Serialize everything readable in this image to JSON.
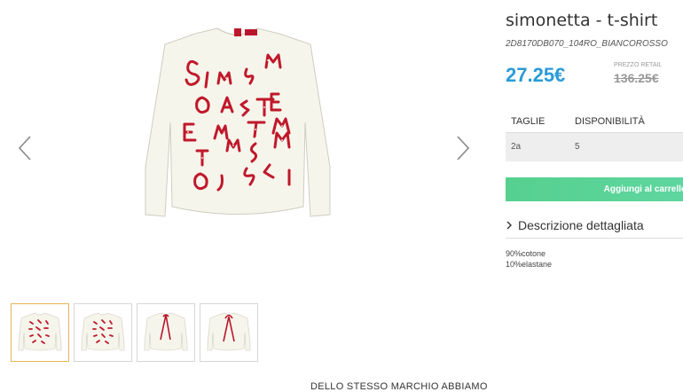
{
  "product": {
    "title": "simonetta - t-shirt",
    "sku": "2D8170DB070_104RO_BIANCOROSSO",
    "price": "27.25€",
    "retail_label": "PREZZO RETAIL",
    "retail_price": "136.25€"
  },
  "sizes": {
    "headers": [
      "TAGLIE",
      "DISPONIBILITÀ"
    ],
    "rows": [
      [
        "2a",
        "5"
      ]
    ]
  },
  "actions": {
    "add_to_cart": "Aggiungi al carrello"
  },
  "description": {
    "toggle_label": "Descrizione dettagliata",
    "composition": [
      "90%cotone",
      "10%elastane"
    ]
  },
  "gallery": {
    "thumbnails": [
      "front-view",
      "front-view-alt",
      "back-view",
      "back-view-alt"
    ],
    "active_index": 0
  },
  "section": {
    "heading": "DELLO STESSO MARCHIO ABBIAMO"
  },
  "colors": {
    "price": "#2a9bd8",
    "button": "#56d08f",
    "letters": "#c0182a"
  }
}
